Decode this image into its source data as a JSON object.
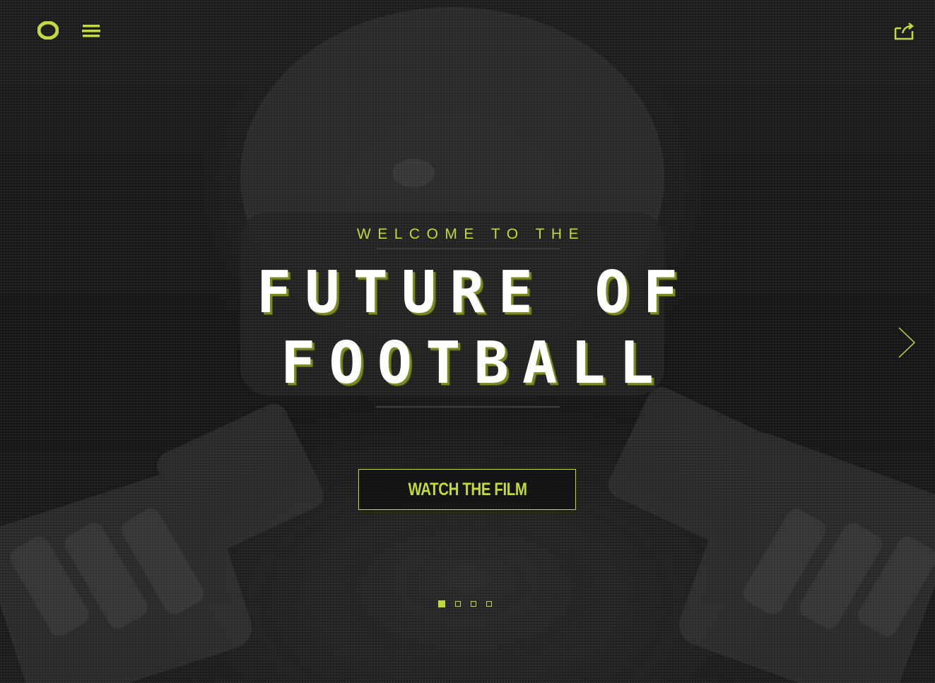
{
  "colors": {
    "accent": "#c5d83a",
    "background": "#1a1a1a",
    "headline": "#ffffff"
  },
  "header": {
    "logo_icon": "oregon-o-logo-icon",
    "menu_icon": "hamburger-menu-icon",
    "share_icon": "share-icon"
  },
  "hero": {
    "kicker": "WELCOME TO THE",
    "headline_line1": "FUTURE OF",
    "headline_line2": "FOOTBALL",
    "cta_label": "WATCH THE FILM"
  },
  "carousel": {
    "next_icon": "chevron-right-icon",
    "slides": 4,
    "active_slide": 1
  }
}
